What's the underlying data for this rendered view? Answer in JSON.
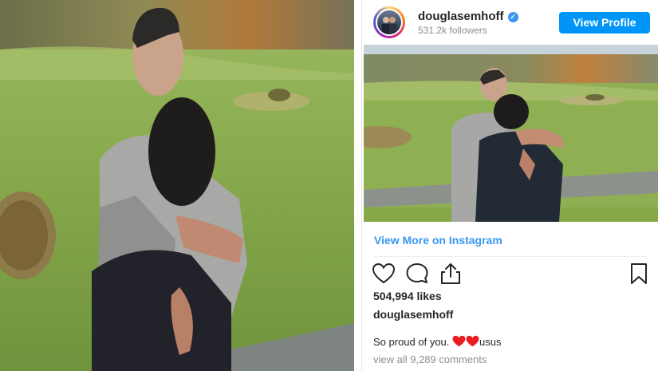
{
  "post": {
    "username": "douglasemhoff",
    "followers": "531.2k followers",
    "view_profile_label": "View Profile",
    "view_more_label": "View More on Instagram",
    "likes": "504,994 likes",
    "caption_author": "douglasemhoff",
    "caption_text": "So proud of you.",
    "caption_tail": "usus",
    "view_comments": "view all 9,289 comments"
  },
  "icons": [
    "heart-icon",
    "comment-icon",
    "share-icon",
    "bookmark-icon",
    "verified-icon"
  ],
  "colors": {
    "accent": "#0095f6",
    "link": "#3897f0",
    "text": "#262626",
    "muted": "#8e8e8e",
    "heart": "#ed1c24"
  }
}
